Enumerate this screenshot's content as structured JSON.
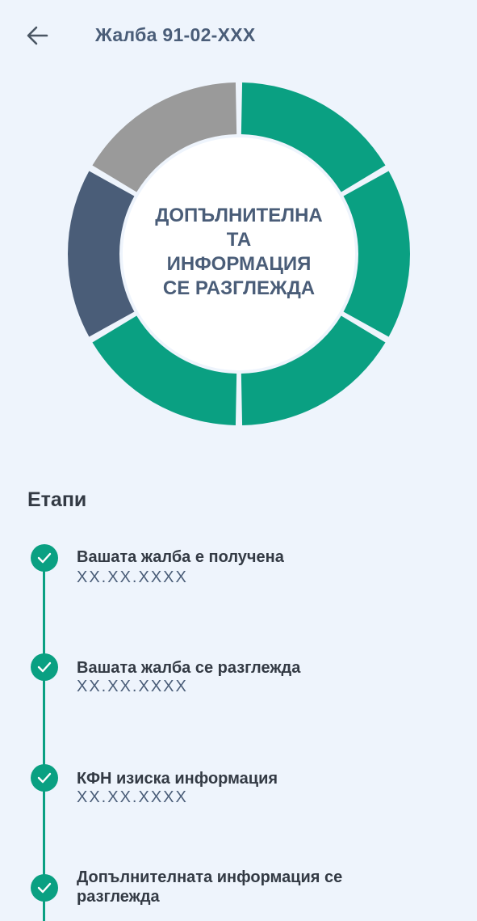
{
  "header": {
    "title": "Жалба 91-02-XXX"
  },
  "status": {
    "lines": [
      "ДОПЪЛНИТЕЛНА",
      "ТА",
      "ИНФОРМАЦИЯ",
      "СЕ РАЗГЛЕЖДА"
    ]
  },
  "progress": {
    "segments": [
      {
        "state": "done",
        "color": "#0aa082"
      },
      {
        "state": "done",
        "color": "#0aa082"
      },
      {
        "state": "done",
        "color": "#0aa082"
      },
      {
        "state": "done",
        "color": "#0aa082"
      },
      {
        "state": "current",
        "color": "#4a5d78"
      },
      {
        "state": "pending",
        "color": "#9a9a9a"
      }
    ]
  },
  "stages": {
    "title": "Етапи",
    "items": [
      {
        "title": "Вашата жалба е получена",
        "date": "XX.XX.XXXX"
      },
      {
        "title": "Вашата жалба се разглежда",
        "date": "XX.XX.XXXX"
      },
      {
        "title": "КФН изиска информация",
        "date": "XX.XX.XXXX"
      },
      {
        "title": "Допълнителната информация се разглежда",
        "date": ""
      }
    ]
  },
  "colors": {
    "accent": "#0aa082",
    "primary": "#4a5d78",
    "background": "#eef4fc"
  }
}
